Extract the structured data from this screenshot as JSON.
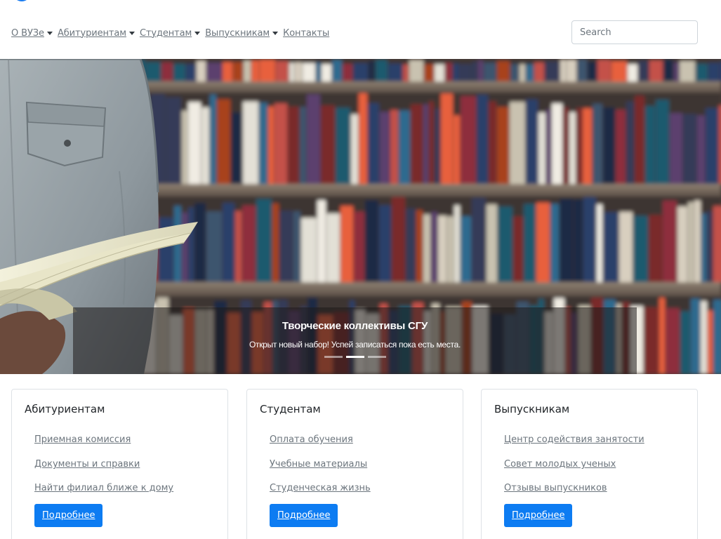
{
  "nav": {
    "items": [
      {
        "label": "О ВУЗе",
        "dropdown": true
      },
      {
        "label": "Абитуриентам",
        "dropdown": true
      },
      {
        "label": "Студентам",
        "dropdown": true
      },
      {
        "label": "Выпускникам",
        "dropdown": true
      },
      {
        "label": "Контакты",
        "dropdown": false
      }
    ],
    "search_placeholder": "Search"
  },
  "hero": {
    "caption_title": "Творческие коллективы СГУ",
    "caption_text": "Открыт новый набор! Успей записаться пока есть места.",
    "slide_count": 3,
    "active_slide": 2
  },
  "cards": [
    {
      "title": "Абитуриентам",
      "links": [
        "Приемная комиссия",
        "Документы и справки",
        "Найти филиал ближе к дому"
      ],
      "button": "Подробнее"
    },
    {
      "title": "Студентам",
      "links": [
        "Оплата обучения",
        "Учебные материалы",
        "Студенческая жизнь"
      ],
      "button": "Подробнее"
    },
    {
      "title": "Выпускникам",
      "links": [
        "Центр содействия занятости",
        "Совет молодых ученых",
        "Отзывы выпускников"
      ],
      "button": "Подробнее"
    }
  ],
  "colors": {
    "brand": "#1a7cf0",
    "button": "#0d7cf2",
    "link": "#6c757d"
  }
}
